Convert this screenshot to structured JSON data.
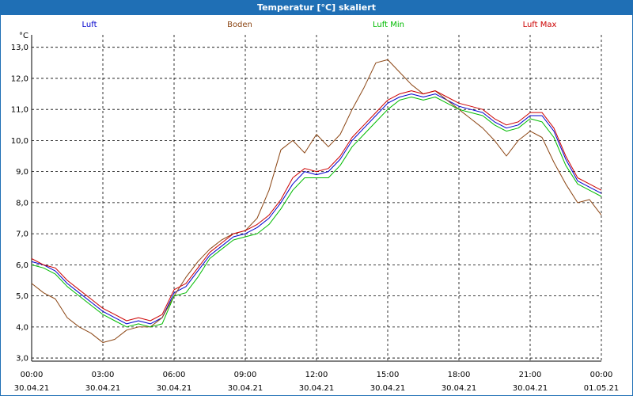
{
  "window": {
    "title": "Temperatur [°C] skaliert"
  },
  "chart_data": {
    "type": "line",
    "title": "Temperatur [°C] skaliert",
    "ylabel": "°C",
    "xlabel": "",
    "ylim": [
      2.9,
      13.4
    ],
    "xlim": [
      0,
      24
    ],
    "grid": true,
    "legend_placement": "top",
    "y_ticks": [
      "3,0",
      "4,0",
      "5,0",
      "6,0",
      "7,0",
      "8,0",
      "9,0",
      "10,0",
      "11,0",
      "12,0",
      "13,0"
    ],
    "x_ticks": [
      {
        "time": "00:00",
        "date": "30.04.21"
      },
      {
        "time": "03:00",
        "date": "30.04.21"
      },
      {
        "time": "06:00",
        "date": "30.04.21"
      },
      {
        "time": "09:00",
        "date": "30.04.21"
      },
      {
        "time": "12:00",
        "date": "30.04.21"
      },
      {
        "time": "15:00",
        "date": "30.04.21"
      },
      {
        "time": "18:00",
        "date": "30.04.21"
      },
      {
        "time": "21:00",
        "date": "30.04.21"
      },
      {
        "time": "00:00",
        "date": "01.05.21"
      }
    ],
    "x_hours": [
      0,
      0.5,
      1,
      1.5,
      2,
      2.5,
      3,
      3.5,
      4,
      4.5,
      5,
      5.5,
      6,
      6.5,
      7,
      7.5,
      8,
      8.5,
      9,
      9.5,
      10,
      10.5,
      11,
      11.5,
      12,
      12.5,
      13,
      13.5,
      14,
      14.5,
      15,
      15.5,
      16,
      16.5,
      17,
      17.5,
      18,
      18.5,
      19,
      19.5,
      20,
      20.5,
      21,
      21.5,
      22,
      22.5,
      23,
      23.5,
      24
    ],
    "series": [
      {
        "name": "Luft",
        "color": "#0000cc",
        "values": [
          6.1,
          6.0,
          5.8,
          5.4,
          5.1,
          4.8,
          4.5,
          4.3,
          4.1,
          4.2,
          4.1,
          4.3,
          5.1,
          5.3,
          5.8,
          6.3,
          6.6,
          6.9,
          7.0,
          7.2,
          7.5,
          8.0,
          8.6,
          9.0,
          8.9,
          9.0,
          9.4,
          10.0,
          10.4,
          10.8,
          11.2,
          11.4,
          11.5,
          11.4,
          11.5,
          11.3,
          11.1,
          11.0,
          10.9,
          10.6,
          10.4,
          10.5,
          10.8,
          10.8,
          10.3,
          9.4,
          8.7,
          8.5,
          8.3
        ]
      },
      {
        "name": "Boden",
        "color": "#8b4513",
        "values": [
          5.4,
          5.1,
          4.9,
          4.3,
          4.0,
          3.8,
          3.5,
          3.6,
          3.9,
          4.0,
          4.0,
          4.3,
          5.0,
          5.6,
          6.1,
          6.5,
          6.8,
          7.0,
          7.1,
          7.5,
          8.4,
          9.7,
          10.0,
          9.6,
          10.2,
          9.8,
          10.2,
          11.0,
          11.7,
          12.5,
          12.6,
          12.2,
          11.8,
          11.5,
          11.6,
          11.3,
          11.0,
          10.7,
          10.4,
          10.0,
          9.5,
          10.0,
          10.3,
          10.1,
          9.3,
          8.6,
          8.0,
          8.1,
          7.6
        ]
      },
      {
        "name": "Luft Min",
        "color": "#00bb00",
        "values": [
          6.0,
          5.9,
          5.7,
          5.3,
          5.0,
          4.7,
          4.4,
          4.2,
          4.0,
          4.1,
          4.0,
          4.1,
          5.0,
          5.1,
          5.6,
          6.2,
          6.5,
          6.8,
          6.9,
          7.0,
          7.3,
          7.8,
          8.4,
          8.8,
          8.8,
          8.8,
          9.2,
          9.8,
          10.2,
          10.6,
          11.0,
          11.3,
          11.4,
          11.3,
          11.4,
          11.2,
          11.0,
          10.9,
          10.8,
          10.5,
          10.3,
          10.4,
          10.7,
          10.6,
          10.1,
          9.2,
          8.6,
          8.4,
          8.2
        ]
      },
      {
        "name": "Luft Max",
        "color": "#cc0000",
        "values": [
          6.2,
          6.0,
          5.9,
          5.5,
          5.2,
          4.9,
          4.6,
          4.4,
          4.2,
          4.3,
          4.2,
          4.4,
          5.2,
          5.4,
          5.9,
          6.4,
          6.7,
          7.0,
          7.1,
          7.3,
          7.6,
          8.1,
          8.8,
          9.1,
          9.0,
          9.1,
          9.5,
          10.1,
          10.5,
          10.9,
          11.3,
          11.5,
          11.6,
          11.5,
          11.6,
          11.4,
          11.2,
          11.1,
          11.0,
          10.7,
          10.5,
          10.6,
          10.9,
          10.9,
          10.4,
          9.5,
          8.8,
          8.6,
          8.4
        ]
      }
    ]
  }
}
